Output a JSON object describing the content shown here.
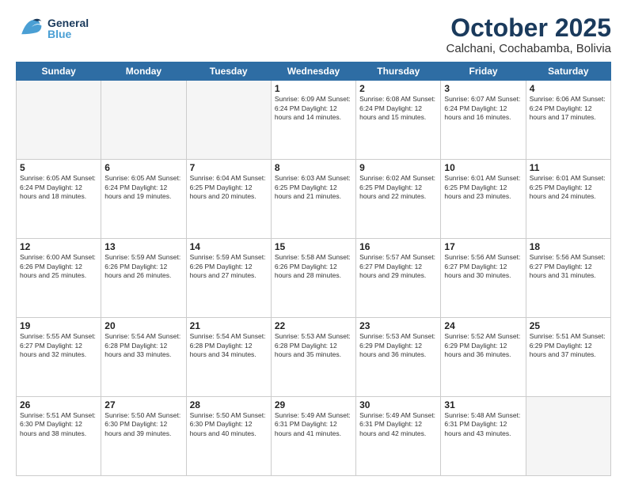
{
  "header": {
    "logo_general": "General",
    "logo_blue": "Blue",
    "month": "October 2025",
    "location": "Calchani, Cochabamba, Bolivia"
  },
  "days_of_week": [
    "Sunday",
    "Monday",
    "Tuesday",
    "Wednesday",
    "Thursday",
    "Friday",
    "Saturday"
  ],
  "weeks": [
    [
      {
        "day": "",
        "info": ""
      },
      {
        "day": "",
        "info": ""
      },
      {
        "day": "",
        "info": ""
      },
      {
        "day": "1",
        "info": "Sunrise: 6:09 AM\nSunset: 6:24 PM\nDaylight: 12 hours\nand 14 minutes."
      },
      {
        "day": "2",
        "info": "Sunrise: 6:08 AM\nSunset: 6:24 PM\nDaylight: 12 hours\nand 15 minutes."
      },
      {
        "day": "3",
        "info": "Sunrise: 6:07 AM\nSunset: 6:24 PM\nDaylight: 12 hours\nand 16 minutes."
      },
      {
        "day": "4",
        "info": "Sunrise: 6:06 AM\nSunset: 6:24 PM\nDaylight: 12 hours\nand 17 minutes."
      }
    ],
    [
      {
        "day": "5",
        "info": "Sunrise: 6:05 AM\nSunset: 6:24 PM\nDaylight: 12 hours\nand 18 minutes."
      },
      {
        "day": "6",
        "info": "Sunrise: 6:05 AM\nSunset: 6:24 PM\nDaylight: 12 hours\nand 19 minutes."
      },
      {
        "day": "7",
        "info": "Sunrise: 6:04 AM\nSunset: 6:25 PM\nDaylight: 12 hours\nand 20 minutes."
      },
      {
        "day": "8",
        "info": "Sunrise: 6:03 AM\nSunset: 6:25 PM\nDaylight: 12 hours\nand 21 minutes."
      },
      {
        "day": "9",
        "info": "Sunrise: 6:02 AM\nSunset: 6:25 PM\nDaylight: 12 hours\nand 22 minutes."
      },
      {
        "day": "10",
        "info": "Sunrise: 6:01 AM\nSunset: 6:25 PM\nDaylight: 12 hours\nand 23 minutes."
      },
      {
        "day": "11",
        "info": "Sunrise: 6:01 AM\nSunset: 6:25 PM\nDaylight: 12 hours\nand 24 minutes."
      }
    ],
    [
      {
        "day": "12",
        "info": "Sunrise: 6:00 AM\nSunset: 6:26 PM\nDaylight: 12 hours\nand 25 minutes."
      },
      {
        "day": "13",
        "info": "Sunrise: 5:59 AM\nSunset: 6:26 PM\nDaylight: 12 hours\nand 26 minutes."
      },
      {
        "day": "14",
        "info": "Sunrise: 5:59 AM\nSunset: 6:26 PM\nDaylight: 12 hours\nand 27 minutes."
      },
      {
        "day": "15",
        "info": "Sunrise: 5:58 AM\nSunset: 6:26 PM\nDaylight: 12 hours\nand 28 minutes."
      },
      {
        "day": "16",
        "info": "Sunrise: 5:57 AM\nSunset: 6:27 PM\nDaylight: 12 hours\nand 29 minutes."
      },
      {
        "day": "17",
        "info": "Sunrise: 5:56 AM\nSunset: 6:27 PM\nDaylight: 12 hours\nand 30 minutes."
      },
      {
        "day": "18",
        "info": "Sunrise: 5:56 AM\nSunset: 6:27 PM\nDaylight: 12 hours\nand 31 minutes."
      }
    ],
    [
      {
        "day": "19",
        "info": "Sunrise: 5:55 AM\nSunset: 6:27 PM\nDaylight: 12 hours\nand 32 minutes."
      },
      {
        "day": "20",
        "info": "Sunrise: 5:54 AM\nSunset: 6:28 PM\nDaylight: 12 hours\nand 33 minutes."
      },
      {
        "day": "21",
        "info": "Sunrise: 5:54 AM\nSunset: 6:28 PM\nDaylight: 12 hours\nand 34 minutes."
      },
      {
        "day": "22",
        "info": "Sunrise: 5:53 AM\nSunset: 6:28 PM\nDaylight: 12 hours\nand 35 minutes."
      },
      {
        "day": "23",
        "info": "Sunrise: 5:53 AM\nSunset: 6:29 PM\nDaylight: 12 hours\nand 36 minutes."
      },
      {
        "day": "24",
        "info": "Sunrise: 5:52 AM\nSunset: 6:29 PM\nDaylight: 12 hours\nand 36 minutes."
      },
      {
        "day": "25",
        "info": "Sunrise: 5:51 AM\nSunset: 6:29 PM\nDaylight: 12 hours\nand 37 minutes."
      }
    ],
    [
      {
        "day": "26",
        "info": "Sunrise: 5:51 AM\nSunset: 6:30 PM\nDaylight: 12 hours\nand 38 minutes."
      },
      {
        "day": "27",
        "info": "Sunrise: 5:50 AM\nSunset: 6:30 PM\nDaylight: 12 hours\nand 39 minutes."
      },
      {
        "day": "28",
        "info": "Sunrise: 5:50 AM\nSunset: 6:30 PM\nDaylight: 12 hours\nand 40 minutes."
      },
      {
        "day": "29",
        "info": "Sunrise: 5:49 AM\nSunset: 6:31 PM\nDaylight: 12 hours\nand 41 minutes."
      },
      {
        "day": "30",
        "info": "Sunrise: 5:49 AM\nSunset: 6:31 PM\nDaylight: 12 hours\nand 42 minutes."
      },
      {
        "day": "31",
        "info": "Sunrise: 5:48 AM\nSunset: 6:31 PM\nDaylight: 12 hours\nand 43 minutes."
      },
      {
        "day": "",
        "info": ""
      }
    ]
  ]
}
